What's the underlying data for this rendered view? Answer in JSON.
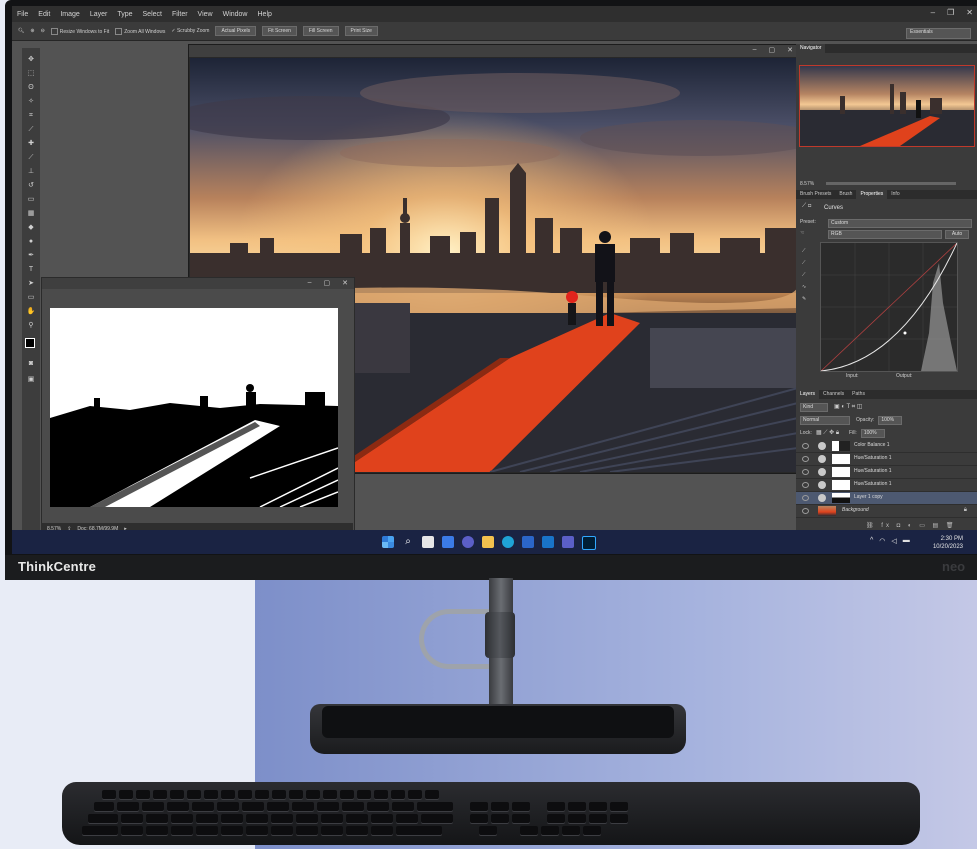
{
  "monitor": {
    "brand": "ThinkCentre",
    "brand_mark": "neo"
  },
  "app": {
    "menu": [
      "File",
      "Edit",
      "Image",
      "Layer",
      "Type",
      "Select",
      "Filter",
      "View",
      "Window",
      "Help"
    ],
    "options": {
      "resize_windows": "Resize Windows to Fit",
      "zoom_all": "Zoom All Windows",
      "scrubby_zoom": "Scrubby Zoom",
      "buttons": [
        "Actual Pixels",
        "Fit Screen",
        "Fill Screen",
        "Print Size"
      ],
      "workspace": "Essentials"
    },
    "statusbar": {
      "zoom": "8.57%",
      "doc": "Doc: 68.7M/99.9M"
    },
    "navigator": {
      "tab": "Navigator",
      "zoom": "8.57%"
    },
    "props_tabs": [
      "Brush Presets",
      "Brush",
      "Properties",
      "Info"
    ],
    "properties": {
      "title": "Curves",
      "preset_label": "Preset:",
      "preset_value": "Custom",
      "channel": "RGB",
      "auto": "Auto",
      "input_label": "Input:",
      "output_label": "Output:"
    },
    "layers_tabs": [
      "Layers",
      "Channels",
      "Paths"
    ],
    "layers_controls": {
      "kind": "Kind",
      "blend": "Normal",
      "opacity_label": "Opacity:",
      "opacity": "100%",
      "lock_label": "Lock:",
      "fill_label": "Fill:",
      "fill": "100%"
    },
    "layers": [
      "Color Balance 1",
      "Hue/Saturation 1",
      "Hue/Saturation 1",
      "Hue/Saturation 1",
      "Layer 1 copy",
      "Background"
    ]
  },
  "taskbar": {
    "time": "2:30 PM",
    "date": "10/20/2023"
  },
  "colors": {
    "accent": "#e0421c",
    "taskbar": "#1a2343"
  }
}
